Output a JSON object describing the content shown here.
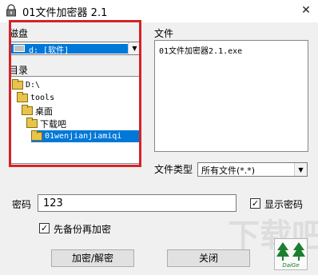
{
  "window": {
    "title": "01文件加密器 2.1",
    "close_glyph": "✕"
  },
  "left": {
    "disk_label": "磁盘",
    "drive_value": "d: [软件]",
    "dir_label": "目录",
    "tree": [
      {
        "label": "D:\\",
        "depth": 0
      },
      {
        "label": "tools",
        "depth": 1
      },
      {
        "label": "桌面",
        "depth": 2
      },
      {
        "label": "下载吧",
        "depth": 3
      },
      {
        "label": "01wenjianjiamiqi",
        "depth": 4,
        "selected": true
      }
    ]
  },
  "right": {
    "file_label": "文件",
    "files": [
      "01文件加密器2.1.exe"
    ],
    "type_label": "文件类型",
    "type_value": "所有文件(*.*)"
  },
  "password": {
    "label": "密码",
    "value": "123",
    "show_label": "显示密码",
    "show_checked": true
  },
  "backup": {
    "label": "先备份再加密",
    "checked": true
  },
  "buttons": {
    "encrypt": "加密/解密",
    "close": "关闭"
  },
  "logo": {
    "text": "DaiGe"
  },
  "watermark": {
    "text": "下载吧"
  },
  "icons": [
    "lock-icon",
    "close-icon",
    "drive-icon",
    "folder-icon",
    "chevron-down-icon",
    "checkmark-icon",
    "tree-logo-icon"
  ],
  "colors": {
    "selection": "#0078d7",
    "highlight_frame": "#d62227",
    "logo_green": "#1a7f2e"
  }
}
